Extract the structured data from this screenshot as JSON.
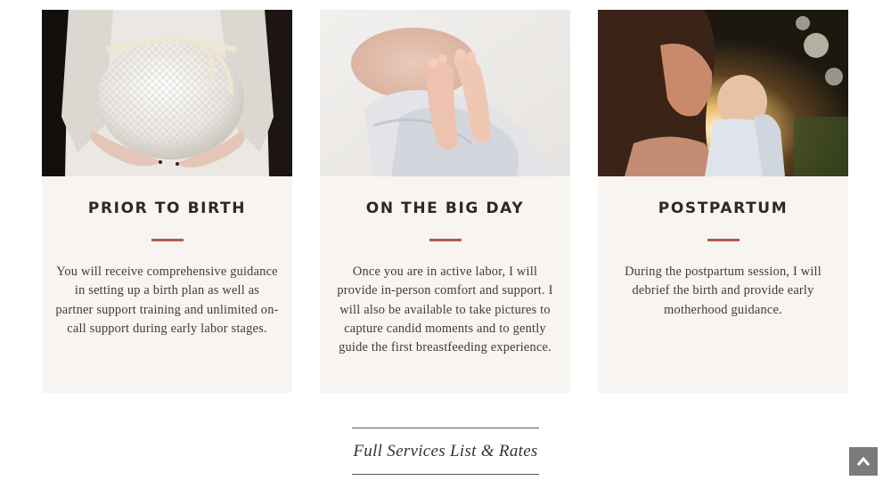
{
  "cards": [
    {
      "title": "PRIOR TO BIRTH",
      "text": "You will receive comprehensive guidance in setting up a birth plan as well as partner support training and unlimited on-call support during early labor stages.",
      "image": "pregnant-belly-photo"
    },
    {
      "title": "ON THE BIG DAY",
      "text": "Once you are in active labor, I will provide in-person comfort and support. I will also be available to take pictures to capture candid moments and to gently guide the first breastfeeding experience.",
      "image": "newborn-feet-photo"
    },
    {
      "title": "POSTPARTUM",
      "text": "During the postpartum session, I will debrief the birth and provide early motherhood guidance.",
      "image": "mother-and-baby-photo"
    }
  ],
  "services_link": "Full Services List & Rates",
  "back_to_top_icon": "chevron-up-icon",
  "colors": {
    "accent": "#b35a4b",
    "card_bg": "#f7f4f1",
    "back_to_top_bg": "#7b7b7b"
  }
}
